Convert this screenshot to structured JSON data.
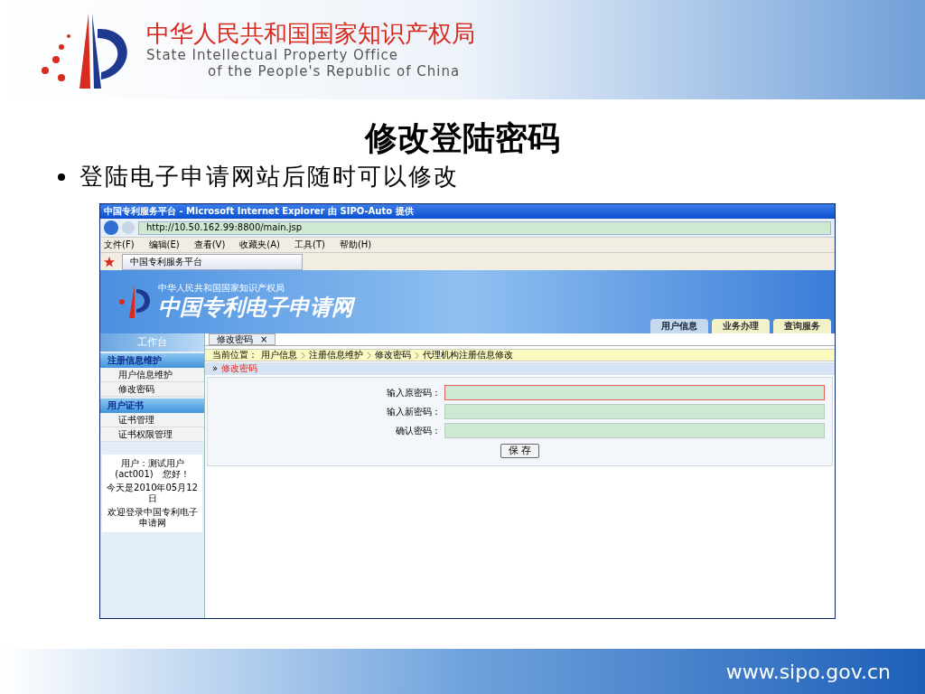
{
  "header": {
    "org_cn": "中华人民共和国国家知识产权局",
    "org_en_1": "State Intellectual Property Office",
    "org_en_2": "of the People's Republic of China"
  },
  "slide": {
    "title": "修改登陆密码",
    "bullets": [
      "登陆电子申请网站后随时可以修改"
    ]
  },
  "browser": {
    "title": "中国专利服务平台 - Microsoft Internet Explorer 由 SIPO-Auto 提供",
    "address": "http://10.50.162.99:8800/main.jsp",
    "menu": [
      "文件(F)",
      "编辑(E)",
      "查看(V)",
      "收藏夹(A)",
      "工具(T)",
      "帮助(H)"
    ],
    "tab": "中国专利服务平台"
  },
  "site": {
    "org": "中华人民共和国国家知识产权局",
    "name": "中国专利电子申请网",
    "nav": [
      {
        "label": "用户信息",
        "selected": true
      },
      {
        "label": "业务办理",
        "selected": false
      },
      {
        "label": "查询服务",
        "selected": false
      }
    ]
  },
  "sidebar": {
    "title": "工作台",
    "groups": [
      {
        "label": "注册信息维护",
        "children": [
          {
            "label": "用户信息维护"
          },
          {
            "label": "修改密码"
          }
        ]
      },
      {
        "label": "用户证书",
        "children": [
          {
            "label": "证书管理"
          },
          {
            "label": "证书权限管理"
          }
        ]
      }
    ],
    "user_info": [
      "用户：测试用户(act001)　您好！",
      "今天是2010年05月12日",
      "欢迎登录中国专利电子申请网"
    ]
  },
  "content": {
    "tab": "修改密码",
    "tab_close": "×",
    "breadcrumb_label": "当前位置：",
    "breadcrumb": [
      "用户信息",
      "注册信息维护",
      "修改密码",
      "代理机构注册信息修改"
    ],
    "section_marker": "»",
    "section": "修改密码",
    "fields": [
      {
        "label": "输入原密码：",
        "focused": true
      },
      {
        "label": "输入新密码：",
        "focused": false
      },
      {
        "label": "确认密码：",
        "focused": false
      }
    ],
    "save_button": "保 存"
  },
  "footer": {
    "url": "www.sipo.gov.cn"
  }
}
